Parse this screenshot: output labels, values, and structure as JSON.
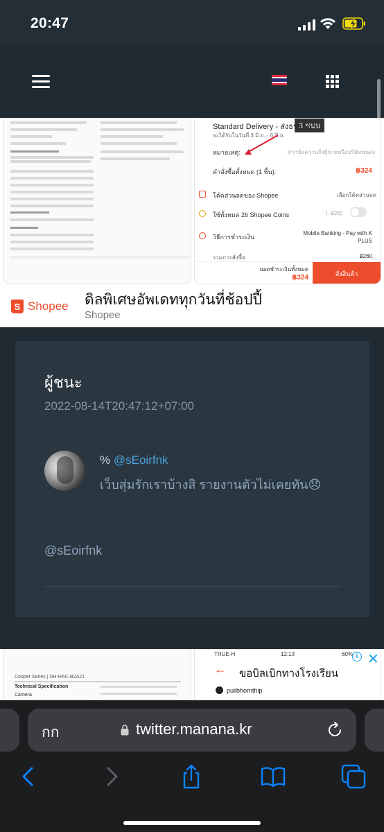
{
  "status_bar": {
    "time": "20:47"
  },
  "site_header": {
    "menu_icon": "hamburger-menu-icon",
    "flag_icon": "thailand-flag-icon",
    "apps_icon": "grid-apps-icon"
  },
  "ad_top": {
    "screenshot_right": {
      "stamp": "3.ชนบ",
      "delivery_title": "Standard Delivery - ส่งธรรมดา",
      "delivery_sub": "จะได้รับในวันที่ 3 มิ.ย. - 6 มิ.ย.",
      "note_label": "หมายเหตุ:",
      "note_hint": "ฝากข้อความถึงผู้ขายหรือบริษัทขนส่ง",
      "order_total_label": "คำสั่งซื้อทั้งหมด (1 ชิ้น):",
      "order_total_price": "฿324",
      "voucher_label": "โค้ดส่วนลดของ Shopee",
      "voucher_action": "เลือกโค้ดส่วนลด",
      "coins_label": "ใช้ทั้งหมด 26 Shopee Coins",
      "coins_value": "[- ฿26]",
      "payment_label": "วิธีการชำระเงิน",
      "payment_value": "Mobile Banking - Pay with K PLUS",
      "subtotal_label": "รวมการสั่งซื้อ",
      "subtotal_value": "฿260",
      "total_label": "ยอดชำระเงินทั้งหมด",
      "total_price": "฿324",
      "order_button": "สั่งสินค้า"
    },
    "brand": "Shopee",
    "title": "ดิลพิเศษอัพเดททุกวันที่ช้อปปี้",
    "source": "Shopee"
  },
  "post": {
    "heading": "ผู้ชนะ",
    "timestamp": "2022-08-14T20:47:12+07:00",
    "tweet_prefix": "%",
    "tweet_handle": "@sEoirfnk",
    "tweet_text": "เว็บสุ่มรักเราบ้างสิ รายงานตัวไม่เคยทัน😞",
    "mention": "@sEoirfnk"
  },
  "ad_bottom": {
    "left": {
      "series_title": "Cooper Series | DH-HAC-B2A21",
      "spec_heading": "Technical Specification",
      "camera_label": "Camera"
    },
    "right": {
      "carrier": "TRUE-H",
      "time": "12:13",
      "battery": "60%",
      "title": "ขอบิลเบิกทางโรงเรียน",
      "account": "puiibhornthip"
    },
    "info_icon": "info-icon",
    "close_label": "✕"
  },
  "safari": {
    "reader_label": "กก",
    "url": "twitter.manana.kr",
    "toolbar": [
      "back-icon",
      "forward-icon",
      "share-icon",
      "bookmarks-icon",
      "tabs-icon"
    ]
  },
  "colors": {
    "background": "#1f2a33",
    "card": "#2a3640",
    "shopee_orange": "#ee4d2d",
    "link_blue": "#4aa3df",
    "muted_text": "#8fa7bd",
    "safari_blue": "#0a84ff"
  }
}
